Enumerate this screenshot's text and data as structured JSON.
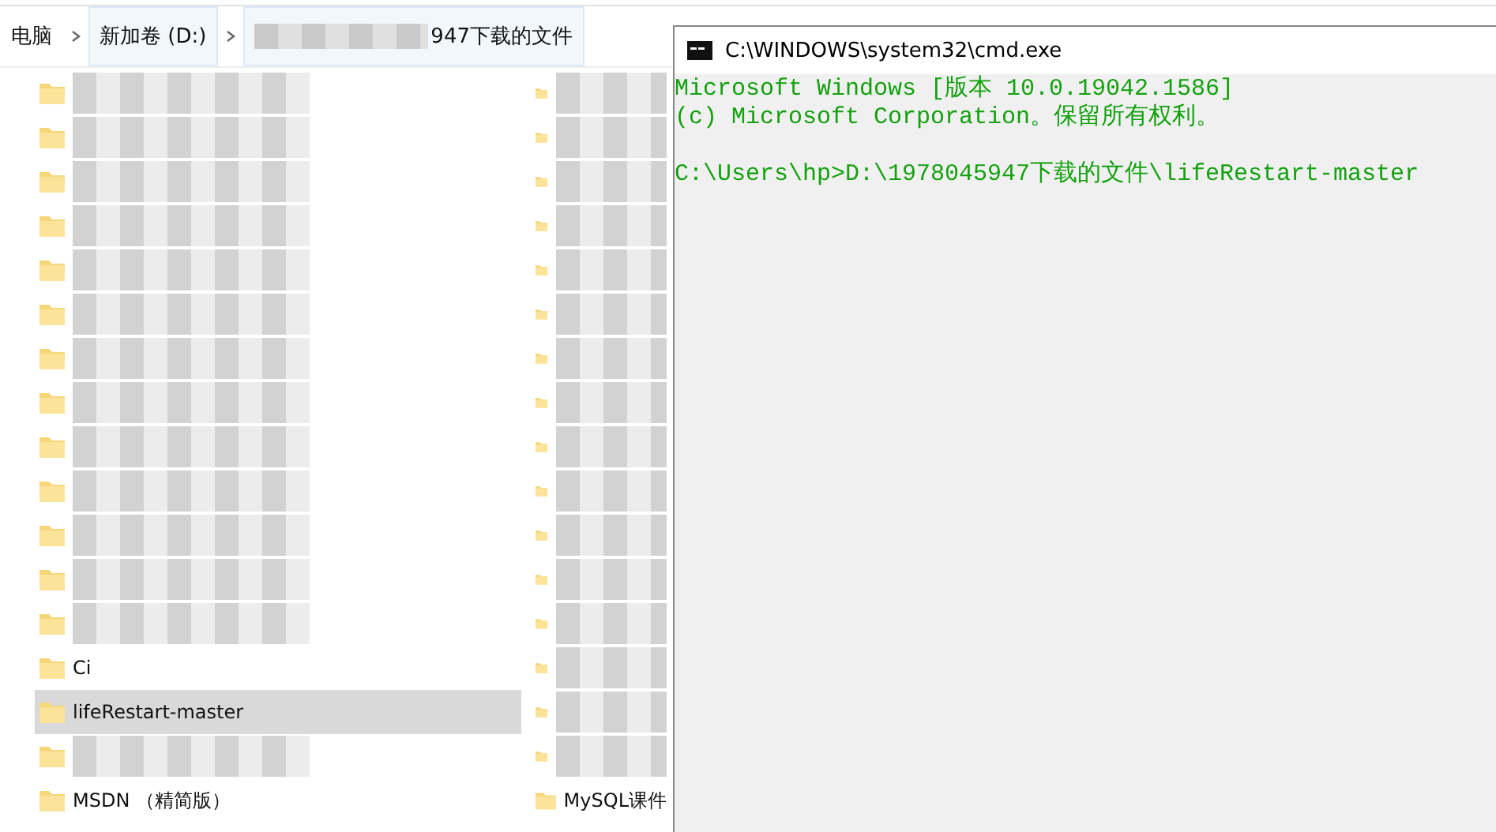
{
  "breadcrumb": [
    {
      "label": "电脑",
      "redacted": false
    },
    {
      "label": "新加卷 (D:)",
      "redacted": false
    },
    {
      "label": "947下载的文件",
      "redacted": true
    }
  ],
  "file_list": {
    "columns": [
      {
        "items": [
          {
            "kind": "redacted",
            "selected": false
          },
          {
            "kind": "redacted",
            "selected": false
          },
          {
            "kind": "redacted",
            "selected": false
          },
          {
            "kind": "redacted",
            "selected": false
          },
          {
            "kind": "redacted",
            "selected": false
          },
          {
            "kind": "redacted",
            "selected": false
          },
          {
            "kind": "redacted",
            "selected": false
          },
          {
            "kind": "redacted",
            "selected": false
          },
          {
            "kind": "redacted",
            "selected": false
          },
          {
            "kind": "redacted",
            "selected": false
          },
          {
            "kind": "redacted",
            "selected": false
          },
          {
            "kind": "redacted",
            "selected": false
          },
          {
            "kind": "redacted",
            "selected": false
          },
          {
            "kind": "named",
            "name": "Ci",
            "selected": false
          },
          {
            "kind": "named",
            "name": "lifeRestart-master",
            "selected": true
          },
          {
            "kind": "redacted",
            "selected": false
          },
          {
            "kind": "named",
            "name": "MSDN （精简版）",
            "selected": false
          }
        ]
      },
      {
        "items": [
          {
            "kind": "redacted",
            "selected": false
          },
          {
            "kind": "redacted",
            "selected": false
          },
          {
            "kind": "redacted",
            "selected": false
          },
          {
            "kind": "redacted",
            "selected": false
          },
          {
            "kind": "redacted",
            "selected": false
          },
          {
            "kind": "redacted",
            "selected": false
          },
          {
            "kind": "redacted",
            "selected": false
          },
          {
            "kind": "redacted",
            "selected": false
          },
          {
            "kind": "redacted",
            "selected": false
          },
          {
            "kind": "redacted",
            "selected": false
          },
          {
            "kind": "redacted",
            "selected": false
          },
          {
            "kind": "redacted",
            "selected": false
          },
          {
            "kind": "redacted",
            "selected": false
          },
          {
            "kind": "redacted",
            "selected": false
          },
          {
            "kind": "redacted",
            "selected": false
          },
          {
            "kind": "redacted",
            "selected": false
          },
          {
            "kind": "named",
            "name": "MySQL课件",
            "selected": false
          }
        ]
      }
    ]
  },
  "cmd_window": {
    "title": "C:\\WINDOWS\\system32\\cmd.exe",
    "blocks": [
      [
        "Microsoft Windows [版本 10.0.19042.1586]",
        "(c) Microsoft Corporation。保留所有权利。"
      ],
      [
        "C:\\Users\\hp>D:\\1978045947下载的文件\\lifeRestart-master"
      ]
    ]
  }
}
